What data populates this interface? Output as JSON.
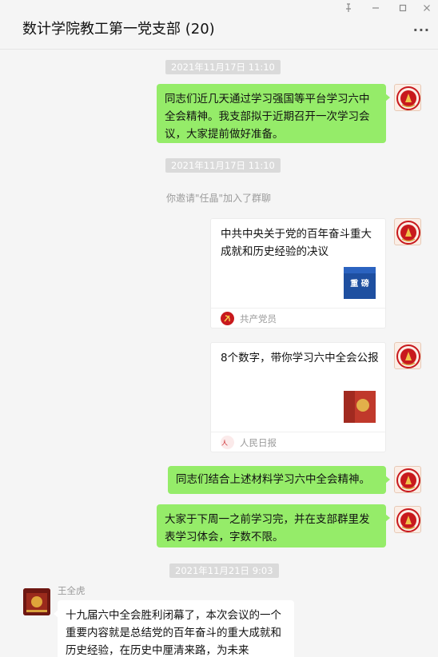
{
  "window": {
    "title": "数计学院教工第一党支部 (20)",
    "controls": {
      "pin": "⊥",
      "minimize": "—",
      "maximize": "▢",
      "close": "✕"
    },
    "more_label": "···"
  },
  "messages": {
    "ts1": "2021年11月17日 11:10",
    "msg1": "同志们近几天通过学习强国等平台学习六中全会精神。我支部拟于近期召开一次学习会议，大家提前做好准备。",
    "ts2": "2021年11月17日 11:10",
    "system1": "你邀请\"任晶\"加入了群聊",
    "card1": {
      "title": "中共中央关于党的百年奋斗重大成就和历史经验的决议",
      "thumb_text": "重 磅",
      "source": "共产党员"
    },
    "card2": {
      "title": "8个数字，带你学习六中全会公报",
      "source": "人民日报"
    },
    "msg2": "同志们结合上述材料学习六中全会精神。",
    "msg3": "大家于下周一之前学习完，并在支部群里发表学习体会，字数不限。",
    "ts3": "2021年11月21日 9:03",
    "sender_name": "王全虎",
    "msg4": "十九届六中全会胜利闭幕了，本次会议的一个重要内容就是总结党的百年奋斗的重大成就和历史经验，在历史中厘清来路，为未来"
  },
  "colors": {
    "bubble_me": "#95ec69",
    "bubble_other": "#ffffff",
    "party_red": "#c8191d",
    "background": "#f5f5f5"
  }
}
